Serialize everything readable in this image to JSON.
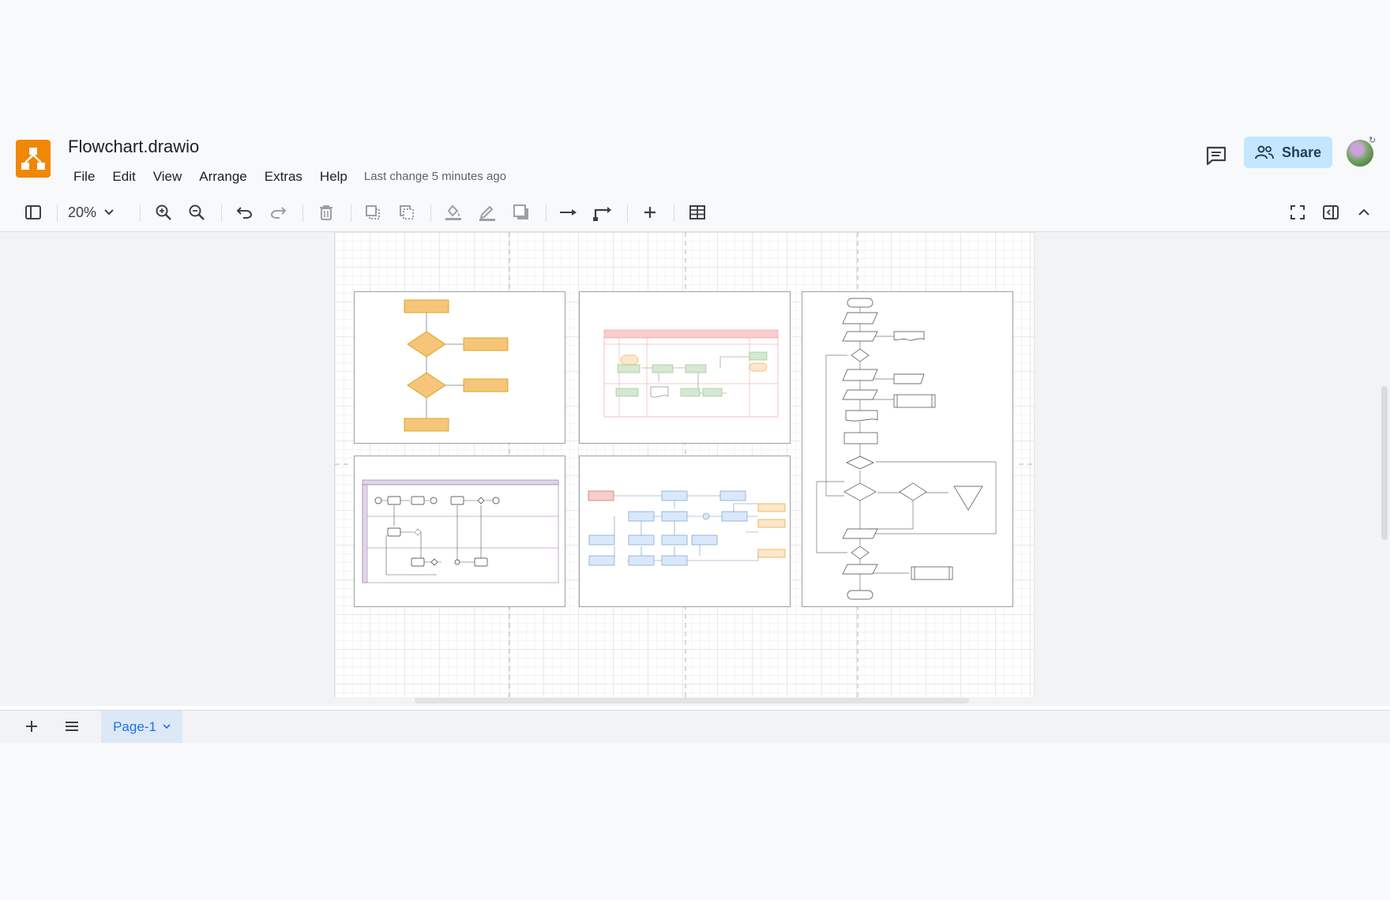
{
  "app": {
    "title": "Flowchart.drawio",
    "last_change": "Last change 5 minutes ago",
    "share_label": "Share"
  },
  "menus": [
    {
      "label": "File"
    },
    {
      "label": "Edit"
    },
    {
      "label": "View"
    },
    {
      "label": "Arrange"
    },
    {
      "label": "Extras"
    },
    {
      "label": "Help"
    }
  ],
  "toolbar": {
    "zoom_value": "20%",
    "icons": [
      "sidebar-toggle-icon",
      "zoom-in-icon",
      "zoom-out-icon",
      "undo-icon",
      "redo-icon",
      "delete-icon",
      "to-front-icon",
      "to-back-icon",
      "fill-color-icon",
      "line-color-icon",
      "shadow-icon",
      "connection-icon",
      "waypoints-icon",
      "insert-icon",
      "table-icon",
      "fullscreen-icon",
      "format-panel-icon",
      "collapse-icon"
    ]
  },
  "pages": {
    "tabs": [
      {
        "label": "Page-1",
        "selected": true
      }
    ]
  },
  "colors": {
    "brand": "#f08705",
    "share_bg": "#c2e7ff",
    "orange_shape": "#f5c57a",
    "blue_shape": "#dae8fc",
    "green_shape": "#d5e8d4",
    "pink_header": "#f8cecc",
    "purple_lane": "#e1d5e7"
  }
}
